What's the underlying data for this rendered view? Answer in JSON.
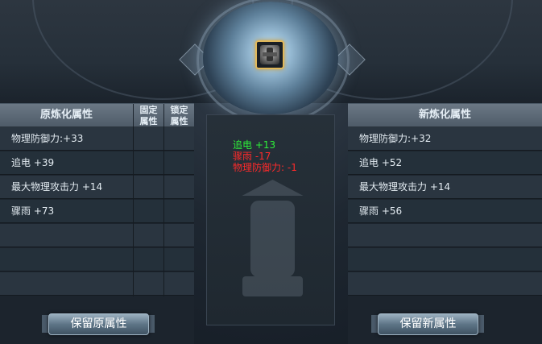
{
  "left_panel": {
    "title": "原炼化属性",
    "col_fixed": [
      "固定",
      "属性"
    ],
    "col_locked": [
      "锁定",
      "属性"
    ],
    "rows": [
      "物理防御力:+33",
      "追电 +39",
      "最大物理攻击力 +14",
      "骤雨 +73",
      "",
      "",
      ""
    ]
  },
  "right_panel": {
    "title": "新炼化属性",
    "rows": [
      "物理防御力:+32",
      "追电 +52",
      "最大物理攻击力 +14",
      "骤雨 +56",
      "",
      "",
      ""
    ]
  },
  "changes": [
    {
      "text": "追电 +13",
      "color": "#2ef03a"
    },
    {
      "text": "骤雨 -17",
      "color": "#ff2a2a"
    },
    {
      "text": "物理防御力: -1",
      "color": "#ff2a2a"
    }
  ],
  "buttons": {
    "keep_original": "保留原属性",
    "keep_new": "保留新属性"
  },
  "item": {
    "icon": "armor-icon",
    "border_color": "#e1b85a"
  }
}
